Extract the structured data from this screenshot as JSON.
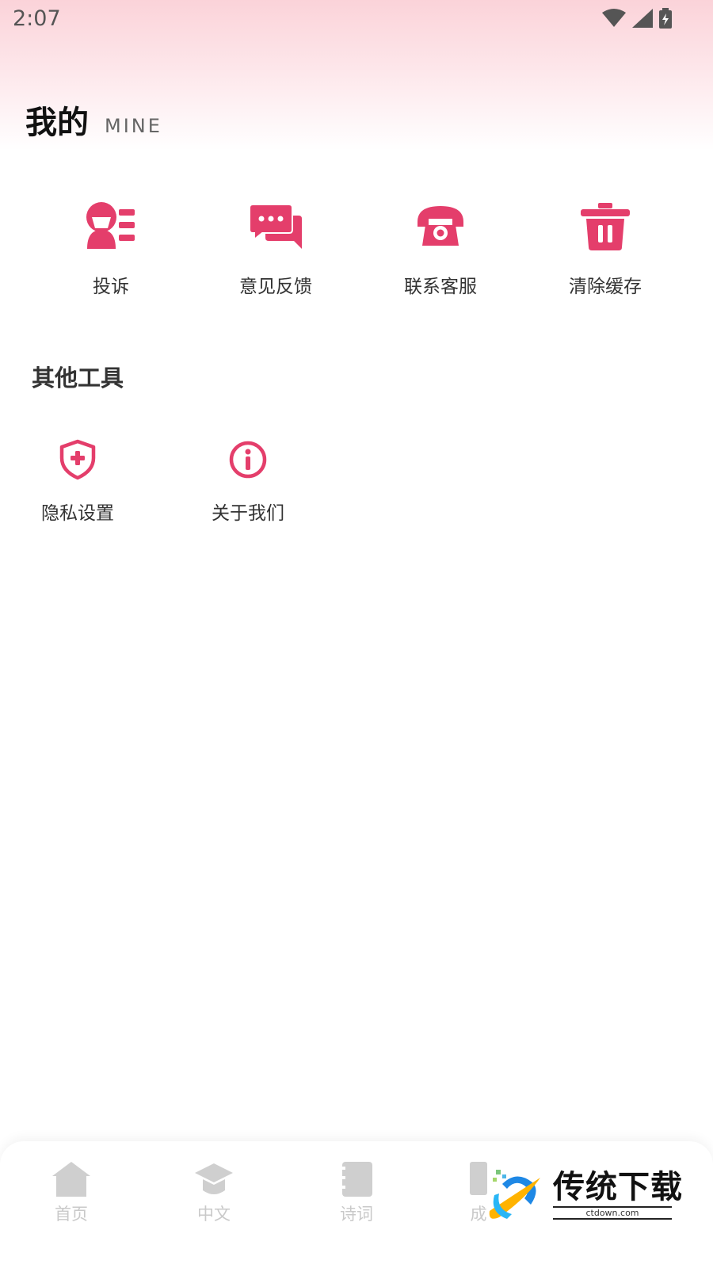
{
  "status_bar": {
    "time": "2:07"
  },
  "header": {
    "title": "我的",
    "subtitle": "MINE"
  },
  "quick_actions": [
    {
      "label": "投诉",
      "icon": "complaint-icon"
    },
    {
      "label": "意见反馈",
      "icon": "feedback-chat-icon"
    },
    {
      "label": "联系客服",
      "icon": "telephone-icon"
    },
    {
      "label": "清除缓存",
      "icon": "trash-icon"
    }
  ],
  "other_tools": {
    "title": "其他工具",
    "items": [
      {
        "label": "隐私设置",
        "icon": "shield-plus-icon"
      },
      {
        "label": "关于我们",
        "icon": "info-icon"
      }
    ]
  },
  "bottom_nav": [
    {
      "label": "首页",
      "icon": "home-icon"
    },
    {
      "label": "中文",
      "icon": "graduation-cap-icon"
    },
    {
      "label": "诗词",
      "icon": "notebook-icon"
    },
    {
      "label": "成",
      "icon": "book-icon"
    }
  ],
  "watermark": {
    "brand": "传统下载",
    "site": "ctdown.com"
  },
  "colors": {
    "accent": "#e43e6b",
    "nav_inactive": "#c9c9c9",
    "header_pink": "#fbd3d9"
  }
}
